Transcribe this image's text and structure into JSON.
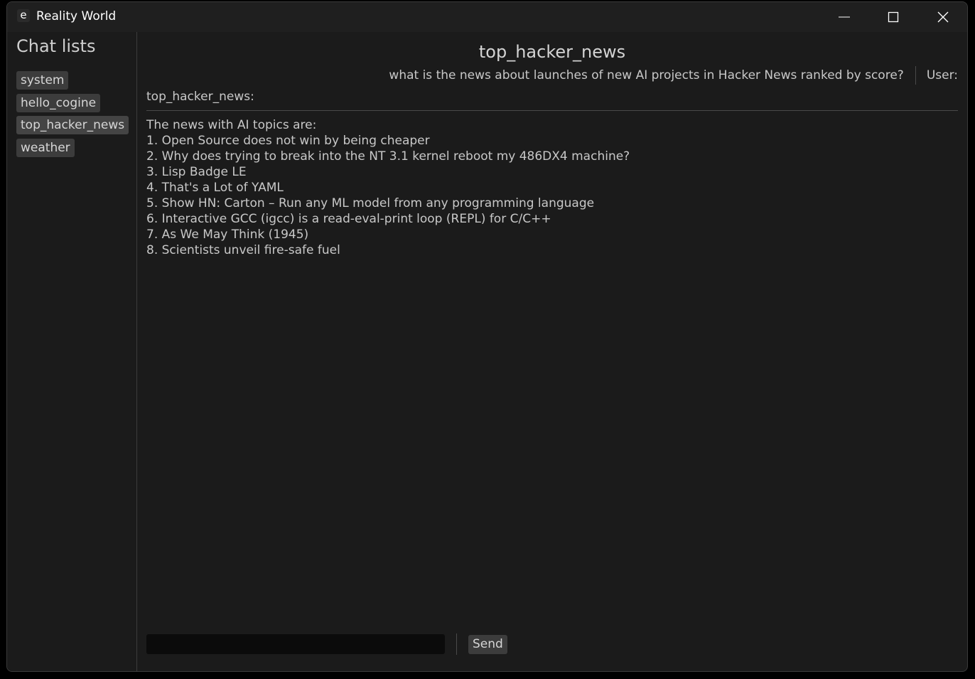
{
  "window": {
    "app_icon": "e",
    "title": "Reality World"
  },
  "sidebar": {
    "title": "Chat lists",
    "items": [
      {
        "label": "system"
      },
      {
        "label": "hello_cogine"
      },
      {
        "label": "top_hacker_news"
      },
      {
        "label": "weather"
      }
    ]
  },
  "main": {
    "chat_name": "top_hacker_news",
    "user_message": "what is the news about launches of new AI projects in Hacker News ranked by score?",
    "user_label": "User:",
    "bot_label": "top_hacker_news:",
    "response_lines": [
      "The news with AI topics are:",
      "1. Open Source does not win by being cheaper",
      "2. Why does trying to break into the NT 3.1 kernel reboot my 486DX4 machine?",
      "3. Lisp Badge LE",
      "4. That's a Lot of YAML",
      "5. Show HN: Carton – Run any ML model from any programming language",
      "6. Interactive GCC (igcc) is a read-eval-print loop (REPL) for C/C++",
      "7. As We May Think (1945)",
      "8. Scientists unveil fire-safe fuel"
    ],
    "input_value": "",
    "send_label": "Send"
  }
}
